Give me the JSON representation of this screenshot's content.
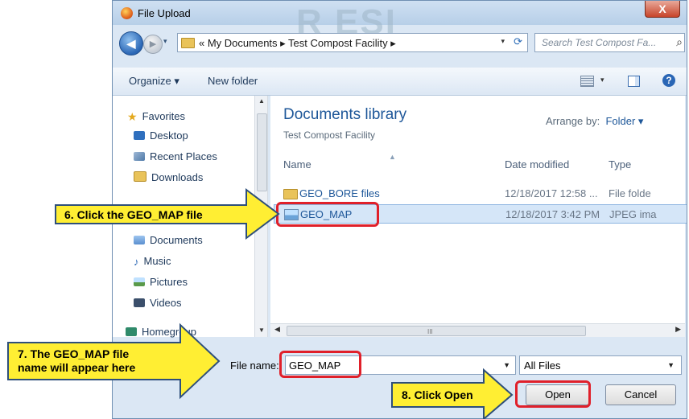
{
  "window": {
    "title": "File Upload",
    "watermark": "R ESI",
    "close_glyph": "X"
  },
  "nav": {
    "back_glyph": "◀",
    "forward_glyph": "▶",
    "address_path": "«  My Documents  ▸  Test Compost Facility  ▸",
    "search_placeholder": "Search Test Compost Fa..."
  },
  "toolbar": {
    "organize": "Organize ▾",
    "new_folder": "New folder"
  },
  "sidebar": {
    "items": [
      {
        "label": "Favorites",
        "icon": "star-icon"
      },
      {
        "label": "Desktop",
        "icon": "desktop-icon"
      },
      {
        "label": "Recent Places",
        "icon": "recent-places-icon"
      },
      {
        "label": "Downloads",
        "icon": "downloads-icon"
      },
      {
        "label": "Documents",
        "icon": "documents-icon"
      },
      {
        "label": "Music",
        "icon": "music-icon"
      },
      {
        "label": "Pictures",
        "icon": "pictures-icon"
      },
      {
        "label": "Videos",
        "icon": "videos-icon"
      },
      {
        "label": "Homegroup",
        "icon": "homegroup-icon"
      }
    ]
  },
  "library": {
    "title": "Documents library",
    "subtitle": "Test Compost Facility",
    "arrange_label": "Arrange by:",
    "arrange_value": "Folder ▾"
  },
  "columns": {
    "name": "Name",
    "date": "Date modified",
    "type": "Type"
  },
  "files": [
    {
      "name": "GEO_BORE files",
      "date": "12/18/2017 12:58 ...",
      "type": "File folde",
      "icon": "folder-icon",
      "selected": false
    },
    {
      "name": "GEO_MAP",
      "date": "12/18/2017 3:42 PM",
      "type": "JPEG ima",
      "icon": "image-file-icon",
      "selected": true
    }
  ],
  "footer": {
    "filename_label": "File name:",
    "filename_value": "GEO_MAP",
    "filter_value": "All Files",
    "open_label": "Open",
    "cancel_label": "Cancel"
  },
  "scroll_grip": "III",
  "callouts": {
    "step6": "6. Click the GEO_MAP file",
    "step7_line1": "7. The GEO_MAP file",
    "step7_line2": "name will appear here",
    "step8": "8. Click Open"
  },
  "colors": {
    "callout_fill": "#ffee33",
    "callout_stroke": "#2e4f7a",
    "highlight": "#e0202a",
    "link_blue": "#1e5799"
  }
}
